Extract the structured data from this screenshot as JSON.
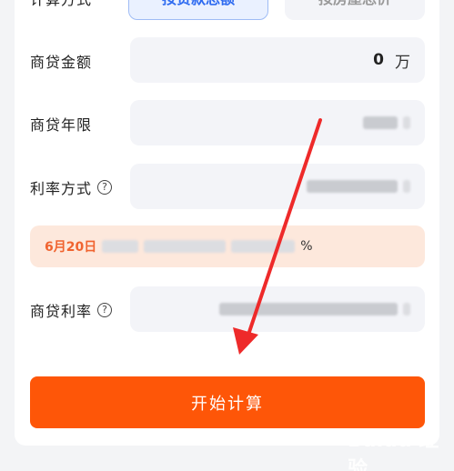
{
  "calc_mode": {
    "label": "计算方式",
    "option_active": "按贷款总额",
    "option_inactive": "按房屋总价"
  },
  "loan_amount": {
    "label": "商贷金额",
    "value": "0",
    "unit": "万"
  },
  "loan_term": {
    "label": "商贷年限"
  },
  "rate_type": {
    "label": "利率方式",
    "help": "?"
  },
  "notice": {
    "date": "6月20日",
    "suffix": "%"
  },
  "loan_rate": {
    "label": "商贷利率",
    "help": "?"
  },
  "calculate_button": "开始计算",
  "colors": {
    "accent": "#fe5608",
    "blue": "#2e6bf0",
    "arrow": "#ee2a2a"
  },
  "watermark": "Baidu 经验"
}
